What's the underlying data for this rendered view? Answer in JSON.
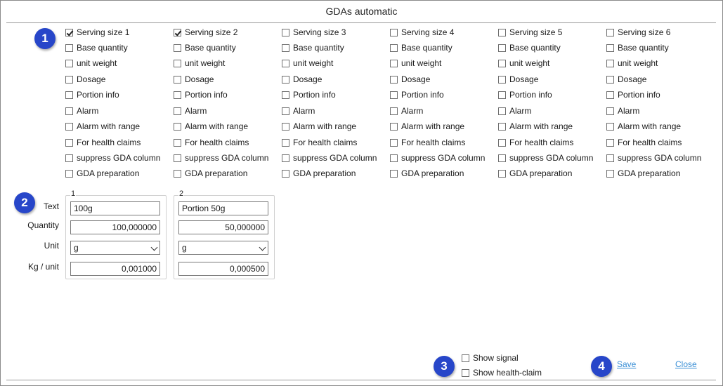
{
  "window": {
    "title": "GDAs automatic"
  },
  "badges": [
    "1",
    "2",
    "3",
    "4"
  ],
  "columns": [
    {
      "serving": "Serving size 1",
      "checked": true
    },
    {
      "serving": "Serving size 2",
      "checked": true
    },
    {
      "serving": "Serving size 3",
      "checked": false
    },
    {
      "serving": "Serving size 4",
      "checked": false
    },
    {
      "serving": "Serving size 5",
      "checked": false
    },
    {
      "serving": "Serving size 6",
      "checked": false
    }
  ],
  "option_labels": [
    "Base quantity",
    "unit weight",
    "Dosage",
    "Portion info",
    "Alarm",
    "Alarm with range",
    "For health claims",
    "suppress GDA column",
    "GDA preparation"
  ],
  "fields": {
    "text": "Text",
    "quantity": "Quantity",
    "unit": "Unit",
    "kg_unit": "Kg / unit"
  },
  "groups": [
    {
      "number": "1",
      "text": "100g",
      "quantity": "100,000000",
      "unit": "g",
      "kg_unit": "0,001000"
    },
    {
      "number": "2",
      "text": "Portion 50g",
      "quantity": "50,000000",
      "unit": "g",
      "kg_unit": "0,000500"
    }
  ],
  "footer": {
    "show_signal": "Show signal",
    "show_health_claim": "Show health-claim",
    "save": "Save",
    "close": "Close"
  },
  "colors": {
    "badge": "#2746c9",
    "link": "#3a8fd6"
  }
}
